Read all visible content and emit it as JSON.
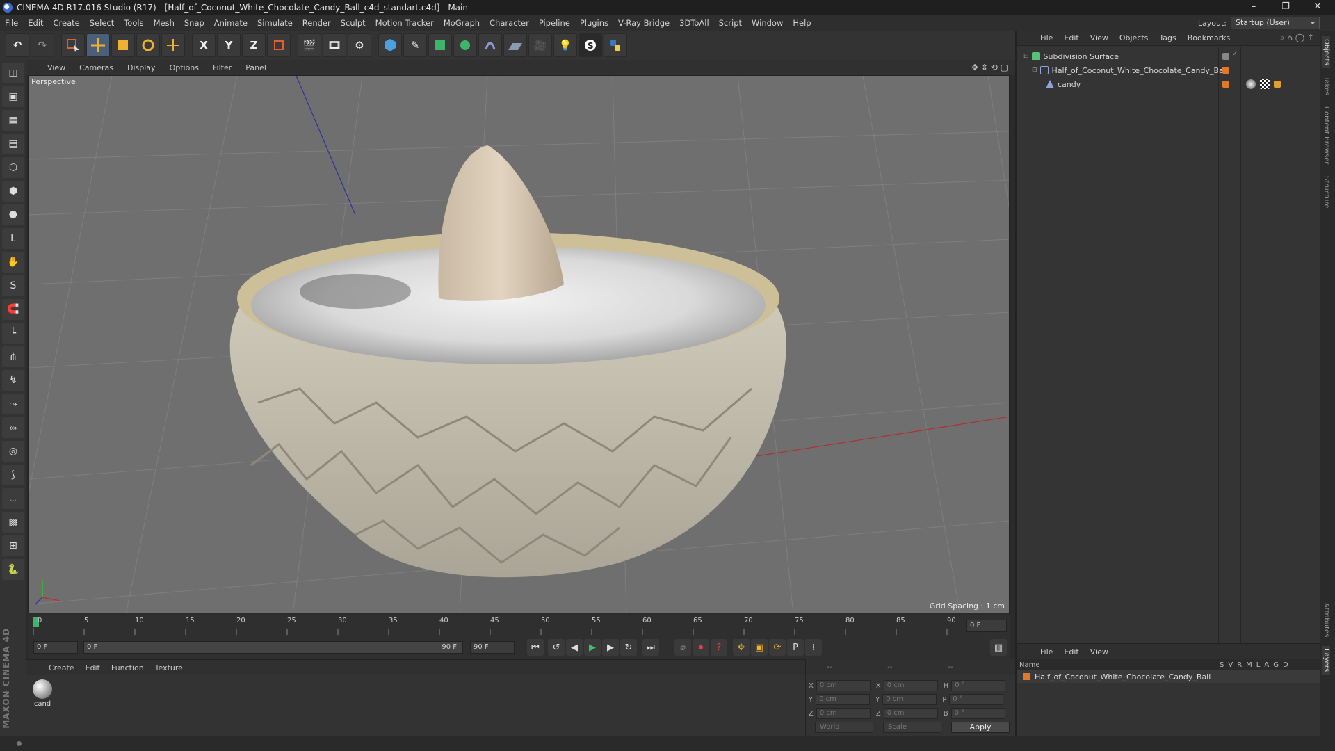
{
  "window": {
    "title": "CINEMA 4D R17.016 Studio (R17) - [Half_of_Coconut_White_Chocolate_Candy_Ball_c4d_standart.c4d] - Main",
    "controls": [
      "–",
      "❐",
      "✕"
    ]
  },
  "menu": [
    "File",
    "Edit",
    "Create",
    "Select",
    "Tools",
    "Mesh",
    "Snap",
    "Animate",
    "Simulate",
    "Render",
    "Sculpt",
    "Motion Tracker",
    "MoGraph",
    "Character",
    "Pipeline",
    "Plugins",
    "V-Ray Bridge",
    "3DToAll",
    "Script",
    "Window",
    "Help"
  ],
  "layout": {
    "label": "Layout:",
    "value": "Startup (User)"
  },
  "toolbar": [
    "undo",
    "redo",
    "live-select",
    "move",
    "scale",
    "rotate",
    "transform",
    "x-axis",
    "y-axis",
    "z-axis",
    "world-coords",
    "render-view",
    "render-region",
    "render-settings",
    "cube",
    "pen",
    "subdivision",
    "cloner",
    "deformer",
    "floor",
    "camera",
    "light",
    "v-ray",
    "python"
  ],
  "toolbar_axes": [
    "X",
    "Y",
    "Z"
  ],
  "viewport": {
    "menu": [
      "View",
      "Cameras",
      "Display",
      "Options",
      "Filter",
      "Panel"
    ],
    "label": "Perspective",
    "grid_spacing": "Grid Spacing : 1 cm"
  },
  "timeline": {
    "ticks": [
      "0",
      "5",
      "10",
      "15",
      "20",
      "25",
      "30",
      "35",
      "40",
      "45",
      "50",
      "55",
      "60",
      "65",
      "70",
      "75",
      "80",
      "85",
      "90"
    ],
    "current_frame_field": "0 F",
    "start_field": "0 F",
    "range_start": "0 F",
    "range_end": "90 F",
    "end_field": "90 F"
  },
  "material_panel": {
    "menu": [
      "Create",
      "Edit",
      "Function",
      "Texture"
    ],
    "materials": [
      {
        "name": "cand"
      }
    ]
  },
  "coords": {
    "header": [
      "--",
      "--",
      "--"
    ],
    "rows": [
      {
        "a": "X",
        "av": "0 cm",
        "b": "X",
        "bv": "0 cm",
        "c": "H",
        "cv": "0 °"
      },
      {
        "a": "Y",
        "av": "0 cm",
        "b": "Y",
        "bv": "0 cm",
        "c": "P",
        "cv": "0 °"
      },
      {
        "a": "Z",
        "av": "0 cm",
        "b": "Z",
        "bv": "0 cm",
        "c": "B",
        "cv": "0 °"
      }
    ],
    "mode1": "World",
    "mode2": "Scale",
    "apply": "Apply"
  },
  "objects_panel": {
    "menu": [
      "File",
      "Edit",
      "View",
      "Objects",
      "Tags",
      "Bookmarks"
    ],
    "items": [
      {
        "name": "Subdivision Surface",
        "indent": 0,
        "color": "#55c27a"
      },
      {
        "name": "Half_of_Coconut_White_Chocolate_Candy_Ball",
        "indent": 1,
        "color": "#8aa7d8"
      },
      {
        "name": "candy",
        "indent": 2,
        "color": "#8aa7d8"
      }
    ]
  },
  "layers_panel": {
    "menu": [
      "File",
      "Edit",
      "View"
    ],
    "header_name": "Name",
    "header_flags": [
      "S",
      "V",
      "R",
      "M",
      "L",
      "A",
      "G",
      "D"
    ],
    "rows": [
      {
        "name": "Half_of_Coconut_White_Chocolate_Candy_Ball",
        "color": "#e07a2a"
      }
    ]
  },
  "side_tabs": [
    "Objects",
    "Takes",
    "Content Browser",
    "Structure",
    "Attributes",
    "Layers"
  ],
  "brand": "MAXON CINEMA 4D"
}
